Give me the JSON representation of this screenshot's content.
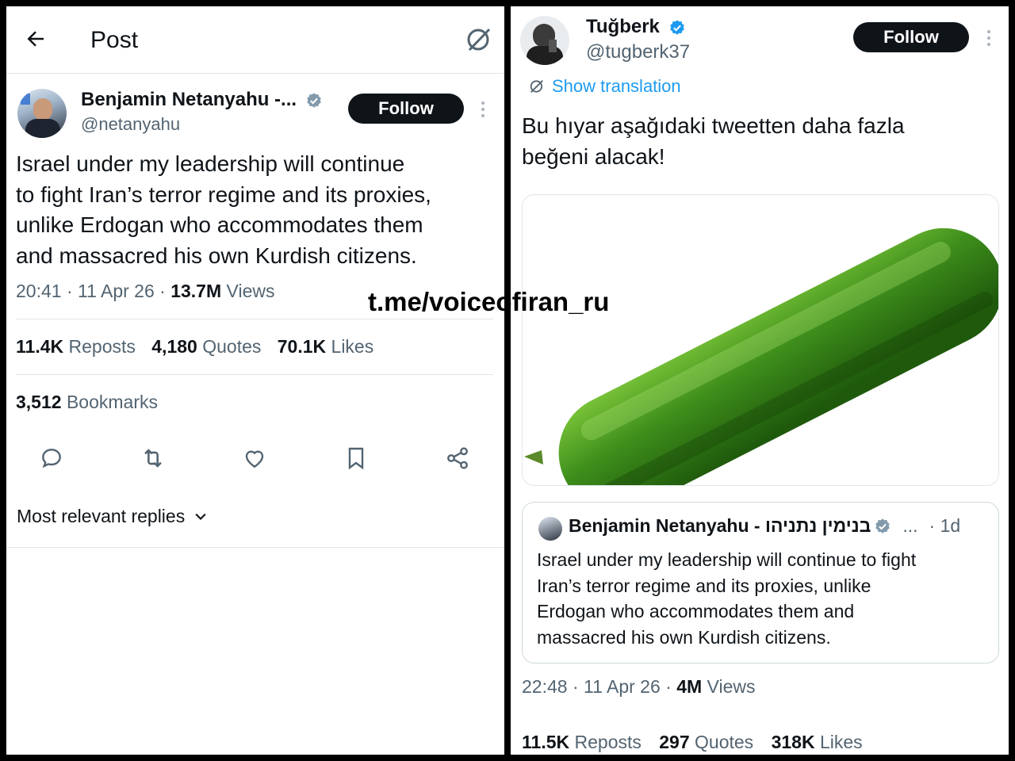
{
  "left": {
    "header": {
      "title": "Post"
    },
    "author": {
      "name": "Benjamin Netanyahu -...",
      "handle": "@netanyahu"
    },
    "follow_label": "Follow",
    "body": [
      "Israel under my leadership will continue",
      "to fight Iran’s terror regime and its proxies,",
      "unlike Erdogan who accommodates them",
      "and massacred his own Kurdish citizens."
    ],
    "meta": {
      "time": "20:41 · 11 Apr 26 · ",
      "views_count": "13.7M",
      "views_label": " Views"
    },
    "stats": [
      {
        "value": "11.4K",
        "label": " Reposts"
      },
      {
        "value": "4,180",
        "label": " Quotes"
      },
      {
        "value": "70.1K",
        "label": " Likes"
      }
    ],
    "bookmarks": {
      "value": "3,512",
      "label": " Bookmarks"
    },
    "replies_sort": "Most relevant replies"
  },
  "watermark": "t.me/voiceofiran_ru",
  "right": {
    "author": {
      "name": "Tuğberk",
      "handle": "@tugberk37"
    },
    "follow_label": "Follow",
    "show_translation": "Show translation",
    "body": [
      "Bu hıyar aşağıdaki tweetten daha fazla",
      "beğeni alacak!"
    ],
    "quoted": {
      "name": "Benjamin Netanyahu - בנימין נתניהו",
      "ellipsis": "...",
      "age": "· 1d",
      "body": [
        "Israel under my leadership will continue to fight",
        "Iran’s terror regime and its proxies, unlike",
        "Erdogan who accommodates them and",
        "massacred his own Kurdish citizens."
      ]
    },
    "meta": {
      "time": "22:48 · 11 Apr 26 · ",
      "views_count": "4M",
      "views_label": " Views"
    },
    "stats": [
      {
        "value": "11.5K",
        "label": " Reposts"
      },
      {
        "value": "297",
        "label": " Quotes"
      },
      {
        "value": "318K",
        "label": " Likes"
      }
    ]
  },
  "colors": {
    "accent": "#1d9bf0",
    "text": "#0f1419",
    "muted": "#536471",
    "button": "#0f1419",
    "verified": "#829aab"
  },
  "icons": [
    "back-arrow-icon",
    "grok-icon",
    "verified-icon",
    "more-icon",
    "reply-icon",
    "repost-icon",
    "like-icon",
    "bookmark-icon",
    "share-icon",
    "chevron-down-icon",
    "translate-icon"
  ]
}
